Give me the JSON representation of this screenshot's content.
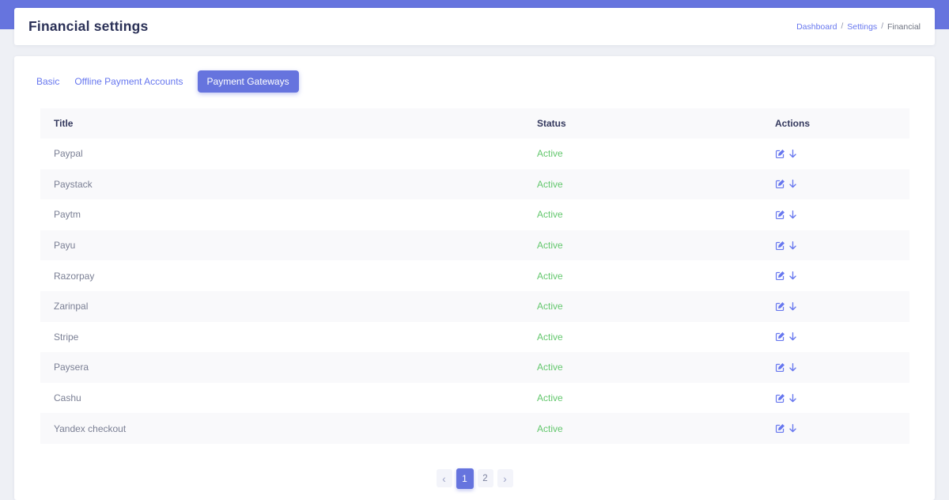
{
  "header": {
    "title": "Financial settings",
    "breadcrumb": {
      "separator": "/",
      "items": [
        {
          "label": "Dashboard",
          "type": "link"
        },
        {
          "label": "Settings",
          "type": "link"
        },
        {
          "label": "Financial",
          "type": "current"
        }
      ]
    }
  },
  "tabs": {
    "items": [
      {
        "label": "Basic",
        "active": false
      },
      {
        "label": "Offline Payment Accounts",
        "active": false
      },
      {
        "label": "Payment Gateways",
        "active": true
      }
    ]
  },
  "table": {
    "columns": {
      "title": "Title",
      "status": "Status",
      "actions": "Actions"
    },
    "rows": [
      {
        "title": "Paypal",
        "status": "Active"
      },
      {
        "title": "Paystack",
        "status": "Active"
      },
      {
        "title": "Paytm",
        "status": "Active"
      },
      {
        "title": "Payu",
        "status": "Active"
      },
      {
        "title": "Razorpay",
        "status": "Active"
      },
      {
        "title": "Zarinpal",
        "status": "Active"
      },
      {
        "title": "Stripe",
        "status": "Active"
      },
      {
        "title": "Paysera",
        "status": "Active"
      },
      {
        "title": "Cashu",
        "status": "Active"
      },
      {
        "title": "Yandex checkout",
        "status": "Active"
      }
    ],
    "row_actions": [
      {
        "name": "edit",
        "icon": "edit-icon"
      },
      {
        "name": "download",
        "icon": "download-icon"
      }
    ]
  },
  "pagination": {
    "prev_label": "‹",
    "next_label": "›",
    "pages": [
      {
        "label": "1",
        "active": true
      },
      {
        "label": "2",
        "active": false
      }
    ]
  },
  "colors": {
    "topbar": "#6674de",
    "primary_link": "#6777ef",
    "status_active": "#63c76d",
    "heading": "#2b3157",
    "page_background": "#eef0f5",
    "row_stripe": "#f9f9fb"
  }
}
